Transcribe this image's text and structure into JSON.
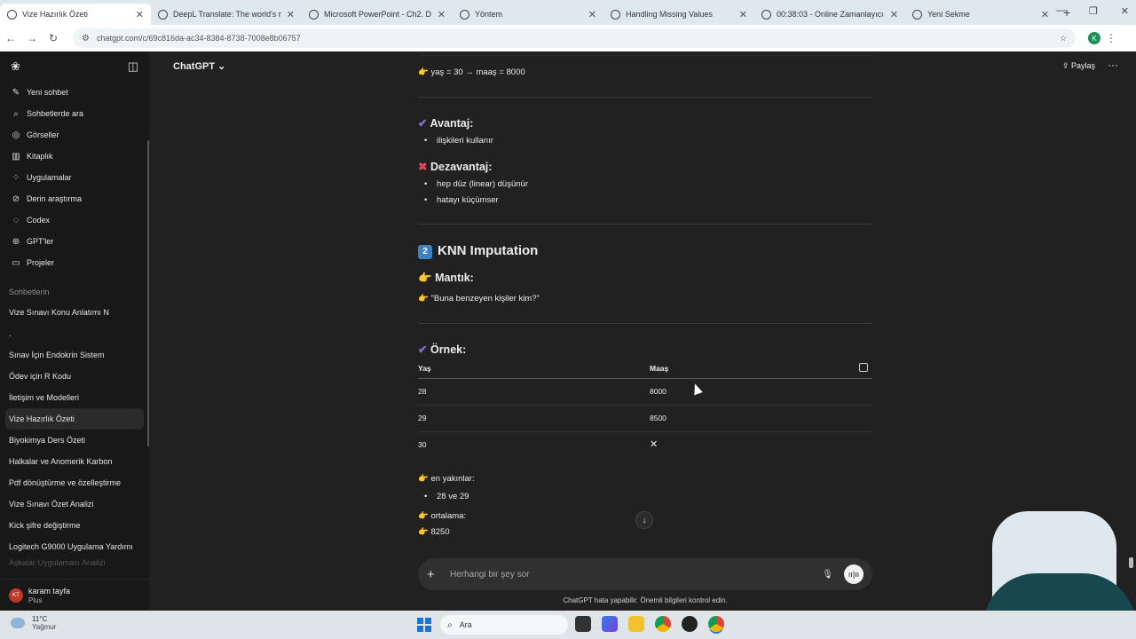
{
  "browser": {
    "tabs": [
      {
        "title": "Vize Hazırlık Özeti",
        "active": true
      },
      {
        "title": "DeepL Translate: The world's m"
      },
      {
        "title": "Microsoft PowerPoint - Ch2. D"
      },
      {
        "title": "Yöntem"
      },
      {
        "title": "Handling Missing Values"
      },
      {
        "title": "00:38:03 - Online Zamanlayıcı -"
      },
      {
        "title": "Yeni Sekme"
      }
    ],
    "url": "chatgpt.com/c/69c816da-ac34-8384-8738-7008e8b06757",
    "profile_initial": "K"
  },
  "sidebar": {
    "nav": [
      {
        "label": "Yeni sohbet",
        "icon": "edit-icon"
      },
      {
        "label": "Sohbetlerde ara",
        "icon": "search-icon"
      },
      {
        "label": "Görseller",
        "icon": "image-icon"
      },
      {
        "label": "Kitaplık",
        "icon": "library-icon"
      },
      {
        "label": "Uygulamalar",
        "icon": "apps-icon"
      },
      {
        "label": "Derin araştırma",
        "icon": "telescope-icon"
      },
      {
        "label": "Codex",
        "icon": "codex-icon"
      },
      {
        "label": "GPT'ler",
        "icon": "gpts-icon"
      },
      {
        "label": "Projeler",
        "icon": "folder-icon"
      }
    ],
    "section_label": "Sohbetlerin",
    "chats": [
      "Vize Sınavı Konu Anlatımı N",
      ".",
      "Sınav İçin Endokrin Sistem",
      "Ödev için R Kodu",
      "İletişim ve Modelleri",
      "Vize Hazırlık Özeti",
      "Biyokimya Ders Özeti",
      "Halkalar ve Anomerik Karbon",
      "Pdf dönüştürme ve özelleştirme",
      "Vize Sınavı Özet Analizi",
      "Kick şifre değiştirme",
      "Logitech G9000 Uygulama Yardımı",
      "Aşkalar Uygulaması Analizi"
    ],
    "selected_chat_index": 5,
    "user": {
      "name": "karam tayfa",
      "plan": "Plus",
      "initials": "KT"
    }
  },
  "main": {
    "model_label": "ChatGPT",
    "share_label": "Paylaş",
    "line_top": "yaş = 30 → maaş = 8000",
    "advantage_title": "Avantaj:",
    "advantage_items": [
      "ilişkileri kullanır"
    ],
    "disadvantage_title": "Dezavantaj:",
    "disadvantage_items": [
      "hep düz (linear) düşünür",
      "hatayı küçümser"
    ],
    "knn_number": "2",
    "knn_title": "KNN Imputation",
    "logic_title": "Mantık:",
    "logic_text": "\"Buna benzeyen kişiler kim?\"",
    "example_title": "Örnek:",
    "table": {
      "headers": [
        "Yaş",
        "Maaş"
      ],
      "rows": [
        [
          "28",
          "8000"
        ],
        [
          "29",
          "8500"
        ],
        [
          "30",
          "✕"
        ]
      ]
    },
    "nearest_label": "en yakınlar:",
    "nearest_items": [
      "28 ve 29"
    ],
    "avg_label": "ortalama:",
    "avg_value": "8250",
    "composer_placeholder": "Herhangi bir şey sor",
    "disclaimer": "ChatGPT hata yapabilir. Önemli bilgileri kontrol edin."
  },
  "taskbar": {
    "temp": "11°C",
    "weather": "Yağmur",
    "search_label": "Ara"
  }
}
